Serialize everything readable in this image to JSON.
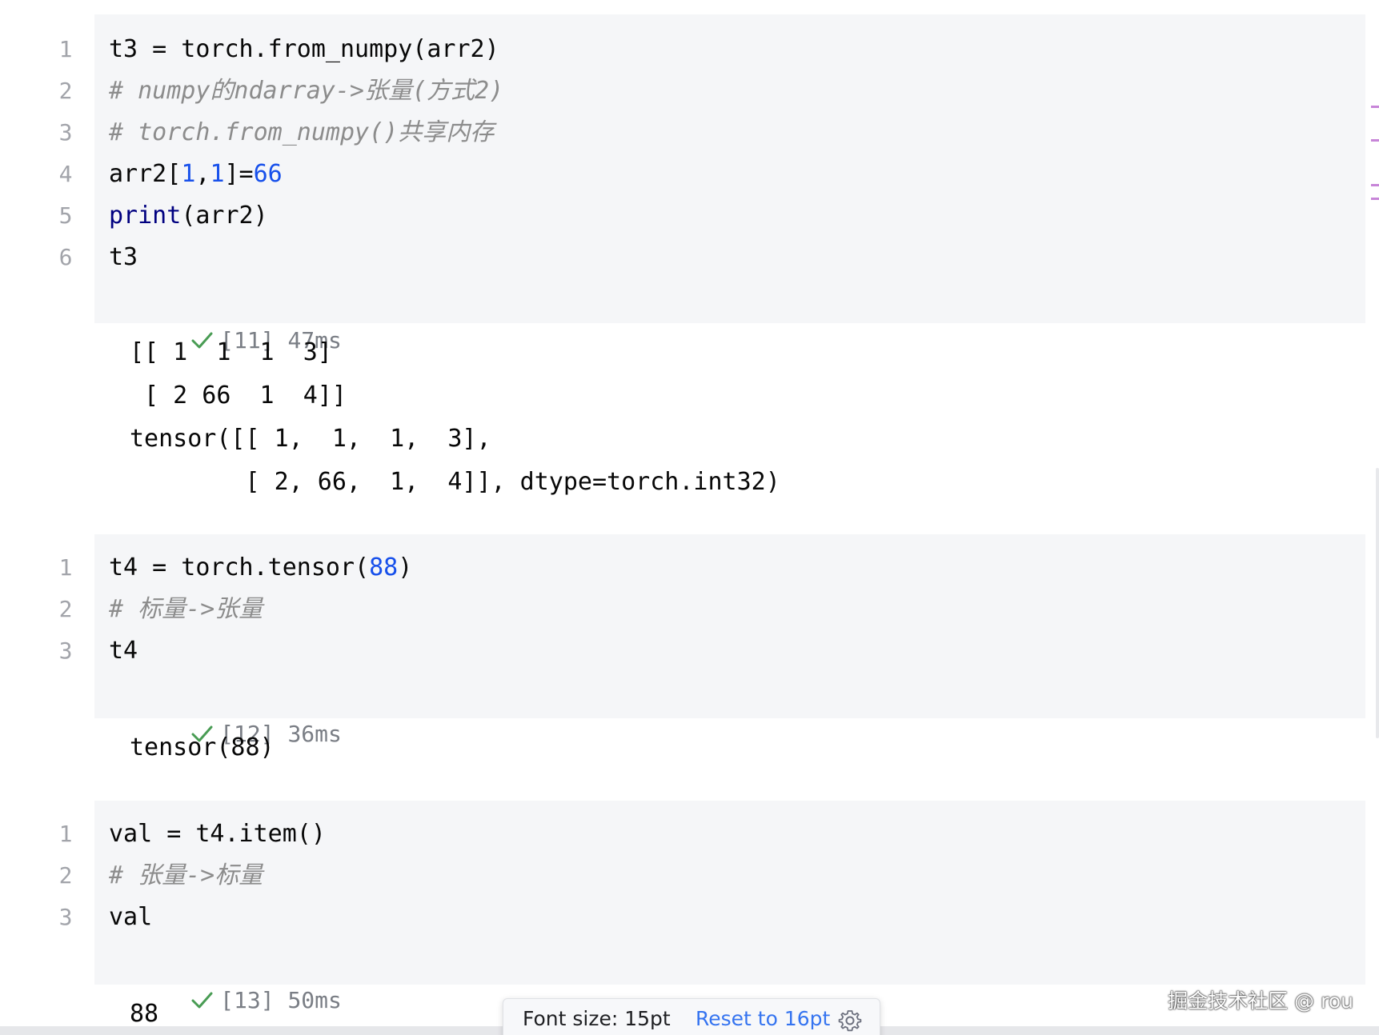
{
  "cells": [
    {
      "status": "[11] 47ms",
      "lines": [
        {
          "no": "1",
          "parts": [
            {
              "t": "t3 = torch.from_numpy(arr2)",
              "c": "plain"
            }
          ]
        },
        {
          "no": "2",
          "parts": [
            {
              "t": "# numpy的ndarray->张量(方式2)",
              "c": "comment"
            }
          ]
        },
        {
          "no": "3",
          "parts": [
            {
              "t": "# torch.from_numpy()共享内存",
              "c": "comment"
            }
          ]
        },
        {
          "no": "4",
          "parts": [
            {
              "t": "arr2[",
              "c": "plain"
            },
            {
              "t": "1",
              "c": "num"
            },
            {
              "t": ",",
              "c": "plain"
            },
            {
              "t": "1",
              "c": "num"
            },
            {
              "t": "]=",
              "c": "plain"
            },
            {
              "t": "66",
              "c": "num"
            }
          ]
        },
        {
          "no": "5",
          "parts": [
            {
              "t": "print",
              "c": "kw"
            },
            {
              "t": "(arr2)",
              "c": "plain"
            }
          ]
        },
        {
          "no": "6",
          "parts": [
            {
              "t": "t3",
              "c": "plain"
            }
          ]
        }
      ],
      "output": [
        "[[ 1  1  1  3]",
        " [ 2 66  1  4]]",
        "tensor([[ 1,  1,  1,  3],",
        "        [ 2, 66,  1,  4]], dtype=torch.int32)"
      ]
    },
    {
      "status": "[12] 36ms",
      "lines": [
        {
          "no": "1",
          "parts": [
            {
              "t": "t4 = torch.tensor(",
              "c": "plain"
            },
            {
              "t": "88",
              "c": "num"
            },
            {
              "t": ")",
              "c": "plain"
            }
          ]
        },
        {
          "no": "2",
          "parts": [
            {
              "t": "# 标量->张量",
              "c": "comment"
            }
          ]
        },
        {
          "no": "3",
          "parts": [
            {
              "t": "t4",
              "c": "plain"
            }
          ]
        }
      ],
      "output": [
        "tensor(88)"
      ]
    },
    {
      "status": "[13] 50ms",
      "lines": [
        {
          "no": "1",
          "parts": [
            {
              "t": "val = t4.item()",
              "c": "plain"
            }
          ]
        },
        {
          "no": "2",
          "parts": [
            {
              "t": "# 张量->标量",
              "c": "comment"
            }
          ]
        },
        {
          "no": "3",
          "parts": [
            {
              "t": "val",
              "c": "plain"
            }
          ]
        }
      ],
      "output": [
        "88"
      ]
    }
  ],
  "font_popup": {
    "label": "Font size: 15pt",
    "reset_label": "Reset to 16pt",
    "icon": "gear-icon"
  },
  "watermark": "掘金技术社区 @ rou",
  "colors": {
    "number": "#1750eb",
    "keyword": "#000080",
    "comment": "#8c8c8c",
    "success_check": "#499c54",
    "link": "#3574f0",
    "cell_background": "#f5f6f8"
  }
}
